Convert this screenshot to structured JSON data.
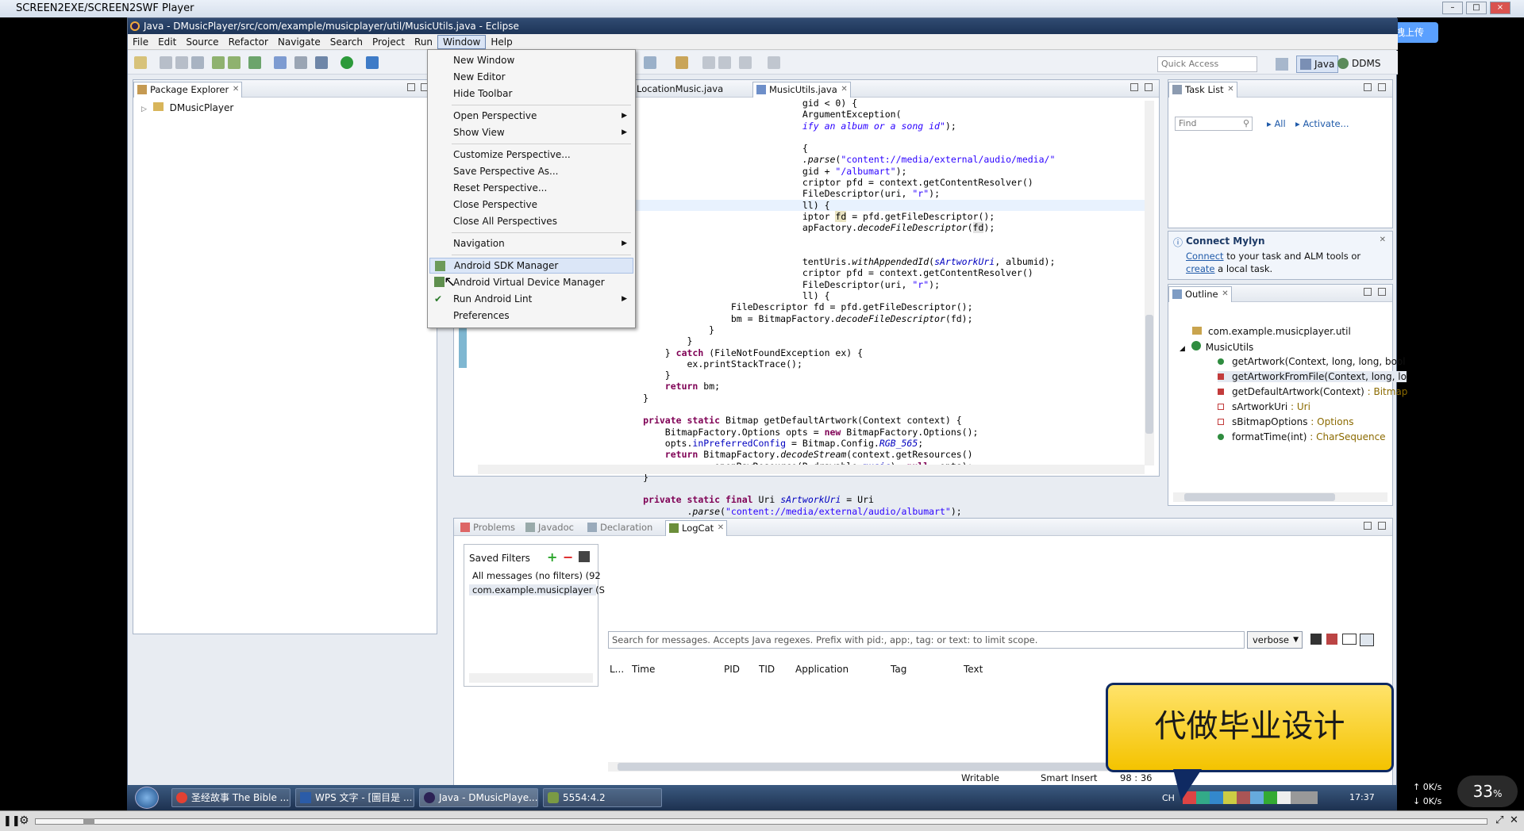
{
  "player": {
    "title": "SCREEN2EXE/SCREEN2SWF Player",
    "upload_label": "拖拽上传",
    "net_up": "0K/s",
    "net_down": "0K/s",
    "meter_value": "33",
    "meter_unit": "%"
  },
  "eclipse": {
    "title": "Java - DMusicPlayer/src/com/example/musicplayer/util/MusicUtils.java - Eclipse",
    "menus": [
      "File",
      "Edit",
      "Source",
      "Refactor",
      "Navigate",
      "Search",
      "Project",
      "Run",
      "Window",
      "Help"
    ],
    "active_menu": "Window",
    "quick_access_placeholder": "Quick Access",
    "perspectives": {
      "java": "Java",
      "ddms": "DDMS"
    }
  },
  "window_menu": {
    "items": [
      {
        "label": "New Window"
      },
      {
        "label": "New Editor"
      },
      {
        "label": "Hide Toolbar"
      },
      {
        "label": "Open Perspective"
      },
      {
        "label": "Show View"
      },
      {
        "label": "Customize Perspective..."
      },
      {
        "label": "Save Perspective As..."
      },
      {
        "label": "Reset Perspective..."
      },
      {
        "label": "Close Perspective"
      },
      {
        "label": "Close All Perspectives"
      },
      {
        "label": "Navigation"
      },
      {
        "label": "Android SDK Manager"
      },
      {
        "label": "Android Virtual Device Manager"
      },
      {
        "label": "Run Android Lint"
      },
      {
        "label": "Preferences"
      }
    ]
  },
  "package_explorer": {
    "tab": "Package Explorer",
    "project": "DMusicPlayer"
  },
  "editor": {
    "tabs": [
      "LocationMusic.java",
      "MusicUtils.java"
    ],
    "active_tab": "MusicUtils.java"
  },
  "task_list": {
    "tab": "Task List",
    "find_placeholder": "Find",
    "all_label": "All",
    "activate_label": "Activate..."
  },
  "mylyn": {
    "title": "Connect Mylyn",
    "connect_link": "Connect",
    "text1": " to your task and ALM tools or",
    "create_link": "create",
    "text2": " a local task."
  },
  "outline": {
    "tab": "Outline",
    "package": "com.example.musicplayer.util",
    "class": "MusicUtils",
    "members": [
      {
        "name": "getArtwork(Context, long, long, bool",
        "type": ""
      },
      {
        "name": "getArtworkFromFile(Context, long, lo",
        "type": ""
      },
      {
        "name": "getDefaultArtwork(Context)",
        "type": " : Bitmap"
      },
      {
        "name": "sArtworkUri",
        "type": " : Uri"
      },
      {
        "name": "sBitmapOptions",
        "type": " : Options"
      },
      {
        "name": "formatTime(int)",
        "type": " : CharSequence"
      }
    ]
  },
  "bottom_views": {
    "tabs": [
      "Problems",
      "Javadoc",
      "Declaration",
      "LogCat"
    ],
    "active_tab": "LogCat"
  },
  "logcat": {
    "saved_filters": "Saved Filters",
    "filters": [
      "All messages (no filters) (92",
      "com.example.musicplayer (S"
    ],
    "search_placeholder": "Search for messages. Accepts Java regexes. Prefix with pid:, app:, tag: or text: to limit scope.",
    "level": "verbose",
    "columns": [
      "L...",
      "Time",
      "PID",
      "TID",
      "Application",
      "Tag",
      "Text"
    ]
  },
  "status": {
    "writable": "Writable",
    "insert_mode": "Smart Insert",
    "position": "98 : 36"
  },
  "taskbar": {
    "buttons": [
      "圣经故事 The Bible ...",
      "WPS 文字 - [圖目是 ...",
      "Java - DMusicPlaye...",
      "5554:4.2"
    ],
    "lang": "CH",
    "clock": "17:37"
  },
  "ad": {
    "text": "代做毕业设计"
  }
}
